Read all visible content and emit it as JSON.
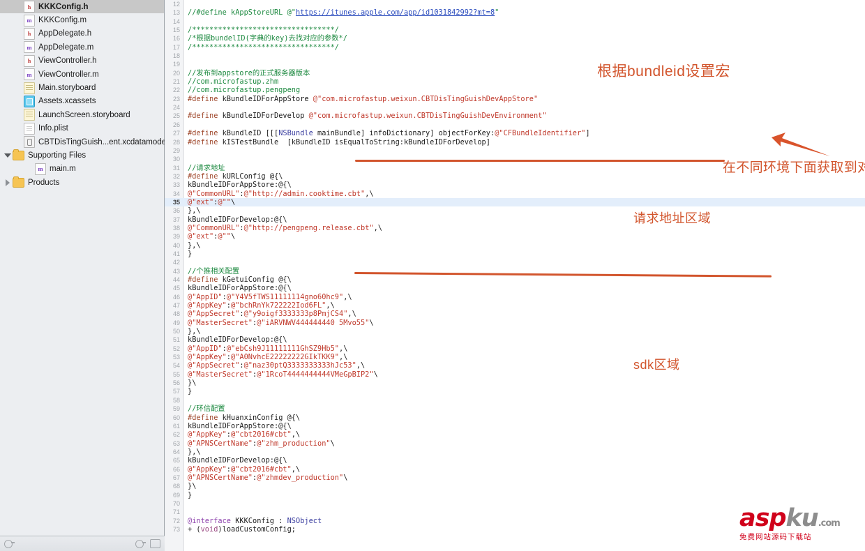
{
  "navigator": {
    "items": [
      {
        "label": "KKKConfig.h",
        "icon": "header-file-icon",
        "glyph": "h",
        "kind": "hfile",
        "indent": 1,
        "disclosure": "none",
        "selected": true
      },
      {
        "label": "KKKConfig.m",
        "icon": "implementation-file-icon",
        "glyph": "m",
        "kind": "mfile",
        "indent": 1,
        "disclosure": "none",
        "selected": false
      },
      {
        "label": "AppDelegate.h",
        "icon": "header-file-icon",
        "glyph": "h",
        "kind": "hfile",
        "indent": 1,
        "disclosure": "none",
        "selected": false
      },
      {
        "label": "AppDelegate.m",
        "icon": "implementation-file-icon",
        "glyph": "m",
        "kind": "mfile",
        "indent": 1,
        "disclosure": "none",
        "selected": false
      },
      {
        "label": "ViewController.h",
        "icon": "header-file-icon",
        "glyph": "h",
        "kind": "hfile",
        "indent": 1,
        "disclosure": "none",
        "selected": false
      },
      {
        "label": "ViewController.m",
        "icon": "implementation-file-icon",
        "glyph": "m",
        "kind": "mfile",
        "indent": 1,
        "disclosure": "none",
        "selected": false
      },
      {
        "label": "Main.storyboard",
        "icon": "storyboard-file-icon",
        "glyph": "",
        "kind": "storyboard",
        "indent": 1,
        "disclosure": "none",
        "selected": false
      },
      {
        "label": "Assets.xcassets",
        "icon": "asset-catalog-icon",
        "glyph": "",
        "kind": "xcassets",
        "indent": 1,
        "disclosure": "none",
        "selected": false
      },
      {
        "label": "LaunchScreen.storyboard",
        "icon": "storyboard-file-icon",
        "glyph": "",
        "kind": "storyboard",
        "indent": 1,
        "disclosure": "none",
        "selected": false
      },
      {
        "label": "Info.plist",
        "icon": "plist-file-icon",
        "glyph": "",
        "kind": "plist",
        "indent": 1,
        "disclosure": "none",
        "selected": false
      },
      {
        "label": "CBTDisTingGuish...ent.xcdatamodeld",
        "icon": "coredata-model-icon",
        "glyph": "",
        "kind": "coredata",
        "indent": 1,
        "disclosure": "none",
        "selected": false
      },
      {
        "label": "Supporting Files",
        "icon": "folder-icon",
        "glyph": "",
        "kind": "folder",
        "indent": 0,
        "disclosure": "open",
        "selected": false
      },
      {
        "label": "main.m",
        "icon": "implementation-file-icon",
        "glyph": "m",
        "kind": "mfile",
        "indent": 2,
        "disclosure": "none",
        "selected": false
      },
      {
        "label": "Products",
        "icon": "folder-icon",
        "glyph": "",
        "kind": "folder",
        "indent": 0,
        "disclosure": "closed",
        "selected": false
      }
    ]
  },
  "editor": {
    "highlighted_line": 35,
    "first_visible_line": 12,
    "lines": [
      {
        "n": 12,
        "text": ""
      },
      {
        "n": 13,
        "text": "//#define kAppStoreURL @\"https://itunes.apple.com/app/id1031842992?mt=8\""
      },
      {
        "n": 14,
        "text": ""
      },
      {
        "n": 15,
        "text": "/*********************************/"
      },
      {
        "n": 16,
        "text": "/*根据bundelID(字典的key)去找对应的参数*/"
      },
      {
        "n": 17,
        "text": "/*********************************/"
      },
      {
        "n": 18,
        "text": ""
      },
      {
        "n": 19,
        "text": ""
      },
      {
        "n": 20,
        "text": "//发布到appstore的正式服务器版本"
      },
      {
        "n": 21,
        "text": "//com.microfastup.zhm"
      },
      {
        "n": 22,
        "text": "//com.microfastup.pengpeng"
      },
      {
        "n": 23,
        "text": "#define kBundleIDForAppStore @\"com.microfastup.weixun.CBTDisTingGuishDevAppStore\""
      },
      {
        "n": 24,
        "text": ""
      },
      {
        "n": 25,
        "text": "#define kBundleIDForDevelop @\"com.microfastup.weixun.CBTDisTingGuishDevEnvironment\""
      },
      {
        "n": 26,
        "text": ""
      },
      {
        "n": 27,
        "text": "#define kBundleID [[[NSBundle mainBundle] infoDictionary] objectForKey:@\"CFBundleIdentifier\"]"
      },
      {
        "n": 28,
        "text": "#define kISTestBundle  [kBundleID isEqualToString:kBundleIDForDevelop]"
      },
      {
        "n": 29,
        "text": ""
      },
      {
        "n": 30,
        "text": ""
      },
      {
        "n": 31,
        "text": "//请求地址"
      },
      {
        "n": 32,
        "text": "#define kURLConfig @{\\"
      },
      {
        "n": 33,
        "text": "kBundleIDForAppStore:@{\\"
      },
      {
        "n": 34,
        "text": "@\"CommonURL\":@\"http://admin.cooktime.cbt\",\\"
      },
      {
        "n": 35,
        "text": "@\"ext\":@\"\"\\"
      },
      {
        "n": 36,
        "text": "},\\"
      },
      {
        "n": 37,
        "text": "kBundleIDForDevelop:@{\\"
      },
      {
        "n": 38,
        "text": "@\"CommonURL\":@\"http://pengpeng.release.cbt\",\\"
      },
      {
        "n": 39,
        "text": "@\"ext\":@\"\"\\"
      },
      {
        "n": 40,
        "text": "},\\"
      },
      {
        "n": 41,
        "text": "}"
      },
      {
        "n": 42,
        "text": ""
      },
      {
        "n": 43,
        "text": "//个推相关配置"
      },
      {
        "n": 44,
        "text": "#define kGetuiConfig @{\\"
      },
      {
        "n": 45,
        "text": "kBundleIDForAppStore:@{\\"
      },
      {
        "n": 46,
        "text": "@\"AppID\":@\"Y4V5fTWS11111114gno60hc9\",\\"
      },
      {
        "n": 47,
        "text": "@\"AppKey\":@\"bchRnYk722222Iod6FL\",\\"
      },
      {
        "n": 48,
        "text": "@\"AppSecret\":@\"y9oigf3333333p8PmjCS4\",\\"
      },
      {
        "n": 49,
        "text": "@\"MasterSecret\":@\"iARVNWV444444440 5Mvo55\"\\"
      },
      {
        "n": 50,
        "text": "},\\"
      },
      {
        "n": 51,
        "text": "kBundleIDForDevelop:@{\\"
      },
      {
        "n": 52,
        "text": "@\"AppID\":@\"ebCsh9J11111111GhSZ9Hb5\",\\"
      },
      {
        "n": 53,
        "text": "@\"AppKey\":@\"A0NvhcE22222222GIkTKK9\",\\"
      },
      {
        "n": 54,
        "text": "@\"AppSecret\":@\"naz30ptQ3333333333hJc53\",\\"
      },
      {
        "n": 55,
        "text": "@\"MasterSecret\":@\"1RcoT4444444444VMeGpBIP2\"\\"
      },
      {
        "n": 56,
        "text": "}\\"
      },
      {
        "n": 57,
        "text": "}"
      },
      {
        "n": 58,
        "text": ""
      },
      {
        "n": 59,
        "text": "//环信配置"
      },
      {
        "n": 60,
        "text": "#define kHuanxinConfig @{\\"
      },
      {
        "n": 61,
        "text": "kBundleIDForAppStore:@{\\"
      },
      {
        "n": 62,
        "text": "@\"AppKey\":@\"cbt2016#cbt\",\\"
      },
      {
        "n": 63,
        "text": "@\"APNSCertName\":@\"zhm_production\"\\"
      },
      {
        "n": 64,
        "text": "},\\"
      },
      {
        "n": 65,
        "text": "kBundleIDForDevelop:@{\\"
      },
      {
        "n": 66,
        "text": "@\"AppKey\":@\"cbt2016#cbt\",\\"
      },
      {
        "n": 67,
        "text": "@\"APNSCertName\":@\"zhmdev_production\"\\"
      },
      {
        "n": 68,
        "text": "}\\"
      },
      {
        "n": 69,
        "text": "}"
      },
      {
        "n": 70,
        "text": ""
      },
      {
        "n": 71,
        "text": ""
      },
      {
        "n": 72,
        "text": "@interface KKKConfig : NSObject"
      },
      {
        "n": 73,
        "text": "+ (void)loadCustomConfig;"
      }
    ]
  },
  "annotations": {
    "color": "#d2552d",
    "bundleid_macro": "根据bundleid设置宏",
    "env_bundleid": "在不同环境下面获取到对应环境的bundleID",
    "url_area": "请求地址区域",
    "sdk_area": "sdk区域"
  },
  "watermark": {
    "asp": "asp",
    "ku": "ku",
    "com": ".com",
    "subtitle": "免费网站源码下载站",
    "red": "#d0021b",
    "grey": "#8d8d8d"
  }
}
